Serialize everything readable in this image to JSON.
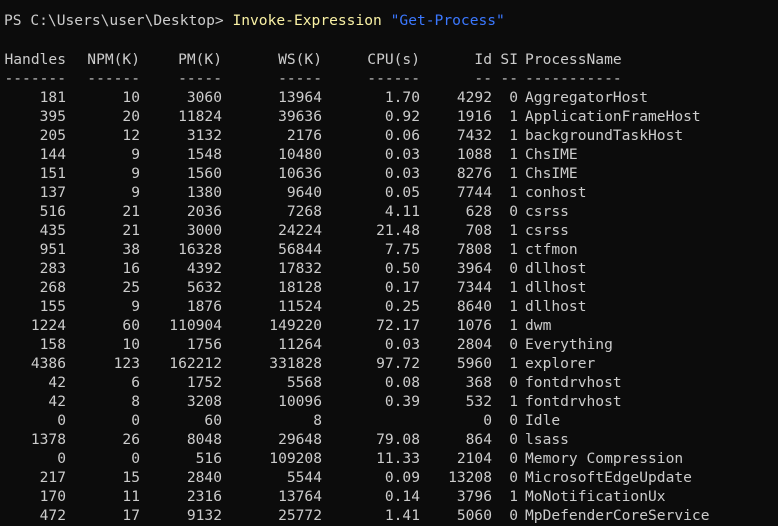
{
  "prompt": {
    "path": "PS C:\\Users\\user\\Desktop>",
    "command": "Invoke-Expression",
    "argument": "\"Get-Process\""
  },
  "colors": {
    "background": "#0c0c0c",
    "foreground": "#cccccc",
    "command": "#f9f1a5",
    "string": "#3b78ff"
  },
  "table": {
    "headers": [
      "Handles",
      "NPM(K)",
      "PM(K)",
      "WS(K)",
      "CPU(s)",
      "Id",
      "SI",
      "ProcessName"
    ],
    "dashes": [
      "-------",
      "------",
      "-----",
      "-----",
      "------",
      "--",
      "--",
      "-----------"
    ],
    "rows": [
      [
        "181",
        "10",
        "3060",
        "13964",
        "1.70",
        "4292",
        "0",
        "AggregatorHost"
      ],
      [
        "395",
        "20",
        "11824",
        "39636",
        "0.92",
        "1916",
        "1",
        "ApplicationFrameHost"
      ],
      [
        "205",
        "12",
        "3132",
        "2176",
        "0.06",
        "7432",
        "1",
        "backgroundTaskHost"
      ],
      [
        "144",
        "9",
        "1548",
        "10480",
        "0.03",
        "1088",
        "1",
        "ChsIME"
      ],
      [
        "151",
        "9",
        "1560",
        "10636",
        "0.03",
        "8276",
        "1",
        "ChsIME"
      ],
      [
        "137",
        "9",
        "1380",
        "9640",
        "0.05",
        "7744",
        "1",
        "conhost"
      ],
      [
        "516",
        "21",
        "2036",
        "7268",
        "4.11",
        "628",
        "0",
        "csrss"
      ],
      [
        "435",
        "21",
        "3000",
        "24224",
        "21.48",
        "708",
        "1",
        "csrss"
      ],
      [
        "951",
        "38",
        "16328",
        "56844",
        "7.75",
        "7808",
        "1",
        "ctfmon"
      ],
      [
        "283",
        "16",
        "4392",
        "17832",
        "0.50",
        "3964",
        "0",
        "dllhost"
      ],
      [
        "268",
        "25",
        "5632",
        "18128",
        "0.17",
        "7344",
        "1",
        "dllhost"
      ],
      [
        "155",
        "9",
        "1876",
        "11524",
        "0.25",
        "8640",
        "1",
        "dllhost"
      ],
      [
        "1224",
        "60",
        "110904",
        "149220",
        "72.17",
        "1076",
        "1",
        "dwm"
      ],
      [
        "158",
        "10",
        "1756",
        "11264",
        "0.03",
        "2804",
        "0",
        "Everything"
      ],
      [
        "4386",
        "123",
        "162212",
        "331828",
        "97.72",
        "5960",
        "1",
        "explorer"
      ],
      [
        "42",
        "6",
        "1752",
        "5568",
        "0.08",
        "368",
        "0",
        "fontdrvhost"
      ],
      [
        "42",
        "8",
        "3208",
        "10096",
        "0.39",
        "532",
        "1",
        "fontdrvhost"
      ],
      [
        "0",
        "0",
        "60",
        "8",
        "",
        "0",
        "0",
        "Idle"
      ],
      [
        "1378",
        "26",
        "8048",
        "29648",
        "79.08",
        "864",
        "0",
        "lsass"
      ],
      [
        "0",
        "0",
        "516",
        "109208",
        "11.33",
        "2104",
        "0",
        "Memory Compression"
      ],
      [
        "217",
        "15",
        "2840",
        "5544",
        "0.09",
        "13208",
        "0",
        "MicrosoftEdgeUpdate"
      ],
      [
        "170",
        "11",
        "2316",
        "13764",
        "0.14",
        "3796",
        "1",
        "MoNotificationUx"
      ],
      [
        "472",
        "17",
        "9132",
        "25772",
        "1.41",
        "5060",
        "0",
        "MpDefenderCoreService"
      ]
    ]
  }
}
